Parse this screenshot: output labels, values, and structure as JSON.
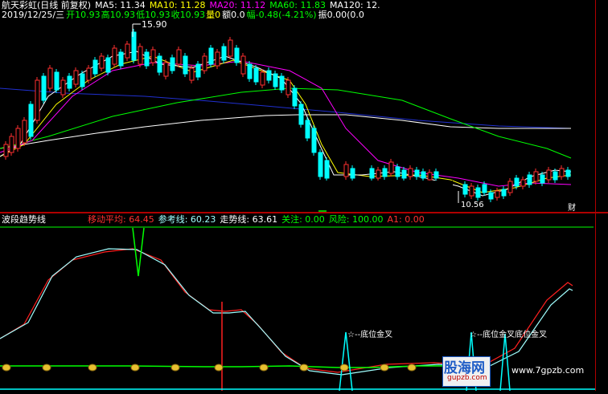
{
  "stock_header": {
    "name": "航天彩虹(日线 前复权)",
    "ma5": "MA5: 11.34",
    "ma10": "MA10: 11.28",
    "ma20": "MA20: 11.12",
    "ma60": "MA60: 11.83",
    "ma120": "MA120: 12.",
    "date": "2019/12/25/三",
    "open": "开10.93",
    "high": "高10.93",
    "low": "低10.93",
    "close": "收10.93",
    "volume": "量0",
    "amount": "额0.0",
    "change": "幅-0.48(-4.21%)",
    "amplitude": "振0.00(0.0"
  },
  "price_annotations": {
    "high_label": "15.90",
    "low_label": "10.56",
    "right_edge_label": "财"
  },
  "indicator_header": {
    "title": "波段趋势线",
    "moving_avg": "移动平均: 64.45",
    "reference": "参考线: 60.23",
    "trend": "走势线: 63.61",
    "attention": "关注: 0.00",
    "risk": "风险: 100.00",
    "a1": "A1: 0.00"
  },
  "indicator_annotations": {
    "signal_1": "☆--底位金叉",
    "signal_2": "☆--底位金叉底位金叉"
  },
  "watermark": {
    "logo": "股海网",
    "sub": "gupzb.com",
    "url": "www.7gpzb.com"
  },
  "colors": {
    "background": "#000000",
    "ma5": "#ffffff",
    "ma10": "#ffff00",
    "ma20": "#ff00ff",
    "ma60": "#00ff00",
    "ma120": "#ffffff",
    "long_line": "#2030d0",
    "up_candle": "#ff3030",
    "down_candle": "#00ffff",
    "trend_red": "#ff2020",
    "trend_cyan": "#a0ffff",
    "attention_green": "#00ff00"
  }
}
